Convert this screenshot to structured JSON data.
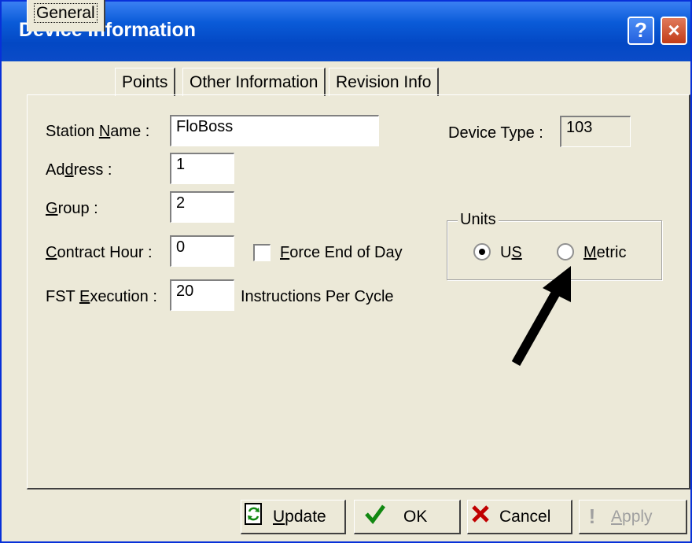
{
  "window": {
    "title": "Device Information",
    "help_glyph": "?",
    "close_glyph": "×"
  },
  "tabs": [
    {
      "label": "General"
    },
    {
      "label": "Points"
    },
    {
      "label": "Other Information"
    },
    {
      "label": "Revision Info"
    }
  ],
  "form": {
    "station_name": {
      "label": "Station Name :",
      "value": "FloBoss"
    },
    "address": {
      "label": "Address :",
      "value": "1"
    },
    "group": {
      "label": "Group :",
      "value": "2"
    },
    "contract_hour": {
      "label": "Contract Hour :",
      "value": "0"
    },
    "force_end_of_day": {
      "label": "Force End of Day",
      "checked": false
    },
    "fst_execution": {
      "label": "FST Execution :",
      "value": "20",
      "suffix": "Instructions Per Cycle"
    },
    "device_type": {
      "label": "Device Type :",
      "value": "103"
    }
  },
  "units": {
    "title": "Units",
    "options": [
      {
        "label": "US",
        "selected": true
      },
      {
        "label": "Metric",
        "selected": false
      }
    ]
  },
  "buttons": {
    "update": "Update",
    "ok": "OK",
    "cancel": "Cancel",
    "apply": "Apply"
  },
  "icons": {
    "update": "refresh-icon",
    "ok": "checkmark-icon",
    "cancel": "x-icon",
    "apply": "exclamation-icon"
  },
  "colors": {
    "title_bar": "#0a5bd8",
    "dialog_bg": "#ece9d8",
    "close_button": "#c23c18",
    "ok_check": "#118811",
    "cancel_x": "#c00000"
  }
}
